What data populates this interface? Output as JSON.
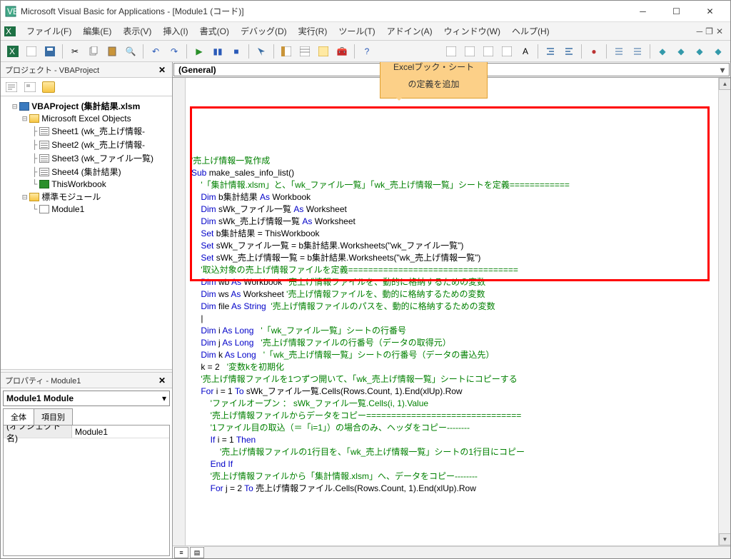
{
  "window": {
    "title": "Microsoft Visual Basic for Applications - [Module1 (コード)]"
  },
  "menu": {
    "file": "ファイル(F)",
    "edit": "編集(E)",
    "view": "表示(V)",
    "insert": "挿入(I)",
    "format": "書式(O)",
    "debug": "デバッグ(D)",
    "run": "実行(R)",
    "tools": "ツール(T)",
    "addins": "アドイン(A)",
    "window": "ウィンドウ(W)",
    "help": "ヘルプ(H)"
  },
  "project_pane": {
    "title": "プロジェクト - VBAProject",
    "root": "VBAProject (集計結果.xlsm",
    "excel_objects": "Microsoft Excel Objects",
    "sheets": [
      "Sheet1 (wk_売上げ情報-",
      "Sheet2 (wk_売上げ情報-",
      "Sheet3 (wk_ファイル一覧)",
      "Sheet4 (集計結果)"
    ],
    "thisworkbook": "ThisWorkbook",
    "std_modules": "標準モジュール",
    "module1": "Module1"
  },
  "properties_pane": {
    "title": "プロパティ - Module1",
    "object": "Module1 Module",
    "tab_all": "全体",
    "tab_category": "項目別",
    "rows": [
      {
        "key": "(オブジェクト名)",
        "val": "Module1"
      }
    ]
  },
  "code": {
    "general": "(General)",
    "lines": [
      {
        "indent": 0,
        "parts": [
          {
            "t": "'売上げ情報一覧作成",
            "c": "c-comment"
          }
        ]
      },
      {
        "indent": 0,
        "parts": [
          {
            "t": "Sub ",
            "c": "c-keyword"
          },
          {
            "t": "make_sales_info_list()",
            "c": "c-text"
          }
        ]
      },
      {
        "indent": 0,
        "parts": [
          {
            "t": "",
            "c": ""
          }
        ]
      },
      {
        "indent": 1,
        "parts": [
          {
            "t": "'「集計情報.xlsm」と、「wk_ファイル一覧」「wk_売上げ情報一覧」シートを定義============",
            "c": "c-comment"
          }
        ]
      },
      {
        "indent": 1,
        "parts": [
          {
            "t": "Dim ",
            "c": "c-keyword"
          },
          {
            "t": "b集計結果 ",
            "c": "c-text"
          },
          {
            "t": "As ",
            "c": "c-keyword"
          },
          {
            "t": "Workbook",
            "c": "c-text"
          }
        ]
      },
      {
        "indent": 1,
        "parts": [
          {
            "t": "Dim ",
            "c": "c-keyword"
          },
          {
            "t": "sWk_ファイル一覧 ",
            "c": "c-text"
          },
          {
            "t": "As ",
            "c": "c-keyword"
          },
          {
            "t": "Worksheet",
            "c": "c-text"
          }
        ]
      },
      {
        "indent": 1,
        "parts": [
          {
            "t": "Dim ",
            "c": "c-keyword"
          },
          {
            "t": "sWk_売上げ情報一覧 ",
            "c": "c-text"
          },
          {
            "t": "As ",
            "c": "c-keyword"
          },
          {
            "t": "Worksheet",
            "c": "c-text"
          }
        ]
      },
      {
        "indent": 0,
        "parts": [
          {
            "t": "",
            "c": ""
          }
        ]
      },
      {
        "indent": 1,
        "parts": [
          {
            "t": "Set ",
            "c": "c-keyword"
          },
          {
            "t": "b集計結果 = ThisWorkbook",
            "c": "c-text"
          }
        ]
      },
      {
        "indent": 1,
        "parts": [
          {
            "t": "Set ",
            "c": "c-keyword"
          },
          {
            "t": "sWk_ファイル一覧 = b集計結果.Worksheets(\"wk_ファイル一覧\")",
            "c": "c-text"
          }
        ]
      },
      {
        "indent": 1,
        "parts": [
          {
            "t": "Set ",
            "c": "c-keyword"
          },
          {
            "t": "sWk_売上げ情報一覧 = b集計結果.Worksheets(\"wk_売上げ情報一覧\")",
            "c": "c-text"
          }
        ]
      },
      {
        "indent": 0,
        "parts": [
          {
            "t": "",
            "c": ""
          }
        ]
      },
      {
        "indent": 0,
        "parts": [
          {
            "t": "",
            "c": ""
          }
        ]
      },
      {
        "indent": 1,
        "parts": [
          {
            "t": "'取込対象の売上げ情報ファイルを定義==================================",
            "c": "c-comment"
          }
        ]
      },
      {
        "indent": 1,
        "parts": [
          {
            "t": "Dim ",
            "c": "c-keyword"
          },
          {
            "t": "wb ",
            "c": "c-text"
          },
          {
            "t": "As ",
            "c": "c-keyword"
          },
          {
            "t": "Workbook  ",
            "c": "c-text"
          },
          {
            "t": "'売上げ情報ファイルを、動的に格納するための変数",
            "c": "c-comment"
          }
        ]
      },
      {
        "indent": 1,
        "parts": [
          {
            "t": "Dim ",
            "c": "c-keyword"
          },
          {
            "t": "ws ",
            "c": "c-text"
          },
          {
            "t": "As ",
            "c": "c-keyword"
          },
          {
            "t": "Worksheet ",
            "c": "c-text"
          },
          {
            "t": "'売上げ情報ファイルを、動的に格納するための変数",
            "c": "c-comment"
          }
        ]
      },
      {
        "indent": 1,
        "parts": [
          {
            "t": "Dim ",
            "c": "c-keyword"
          },
          {
            "t": "file ",
            "c": "c-text"
          },
          {
            "t": "As String  ",
            "c": "c-keyword"
          },
          {
            "t": "'売上げ情報ファイルのパスを、動的に格納するための変数",
            "c": "c-comment"
          }
        ]
      },
      {
        "indent": 0,
        "parts": [
          {
            "t": "",
            "c": ""
          }
        ]
      },
      {
        "indent": 1,
        "parts": [
          {
            "t": "|",
            "c": "c-text"
          }
        ]
      },
      {
        "indent": 1,
        "parts": [
          {
            "t": "Dim ",
            "c": "c-keyword"
          },
          {
            "t": "i ",
            "c": "c-text"
          },
          {
            "t": "As Long   ",
            "c": "c-keyword"
          },
          {
            "t": "'「wk_ファイル一覧」シートの行番号",
            "c": "c-comment"
          }
        ]
      },
      {
        "indent": 1,
        "parts": [
          {
            "t": "Dim ",
            "c": "c-keyword"
          },
          {
            "t": "j ",
            "c": "c-text"
          },
          {
            "t": "As Long   ",
            "c": "c-keyword"
          },
          {
            "t": "'売上げ情報ファイルの行番号（データの取得元）",
            "c": "c-comment"
          }
        ]
      },
      {
        "indent": 1,
        "parts": [
          {
            "t": "Dim ",
            "c": "c-keyword"
          },
          {
            "t": "k ",
            "c": "c-text"
          },
          {
            "t": "As Long   ",
            "c": "c-keyword"
          },
          {
            "t": "'「wk_売上げ情報一覧」シートの行番号（データの書込先）",
            "c": "c-comment"
          }
        ]
      },
      {
        "indent": 1,
        "parts": [
          {
            "t": "k = 2   ",
            "c": "c-text"
          },
          {
            "t": "'変数kを初期化",
            "c": "c-comment"
          }
        ]
      },
      {
        "indent": 0,
        "parts": [
          {
            "t": "",
            "c": ""
          }
        ]
      },
      {
        "indent": 0,
        "parts": [
          {
            "t": "",
            "c": ""
          }
        ]
      },
      {
        "indent": 1,
        "parts": [
          {
            "t": "'売上げ情報ファイルを1つずつ開いて、「wk_売上げ情報一覧」シートにコピーする",
            "c": "c-comment"
          }
        ]
      },
      {
        "indent": 1,
        "parts": [
          {
            "t": "For ",
            "c": "c-keyword"
          },
          {
            "t": "i = 1 ",
            "c": "c-text"
          },
          {
            "t": "To ",
            "c": "c-keyword"
          },
          {
            "t": "sWk_ファイル一覧.Cells(Rows.Count, 1).End(xlUp).Row",
            "c": "c-text"
          }
        ]
      },
      {
        "indent": 0,
        "parts": [
          {
            "t": "",
            "c": ""
          }
        ]
      },
      {
        "indent": 2,
        "parts": [
          {
            "t": "'ファイルオープン ： sWk_ファイル一覧.Cells(i, 1).Value",
            "c": "c-comment"
          }
        ]
      },
      {
        "indent": 0,
        "parts": [
          {
            "t": "",
            "c": ""
          }
        ]
      },
      {
        "indent": 0,
        "parts": [
          {
            "t": "",
            "c": ""
          }
        ]
      },
      {
        "indent": 2,
        "parts": [
          {
            "t": "'売上げ情報ファイルからデータをコピー===============================",
            "c": "c-comment"
          }
        ]
      },
      {
        "indent": 0,
        "parts": [
          {
            "t": "",
            "c": ""
          }
        ]
      },
      {
        "indent": 2,
        "parts": [
          {
            "t": "'1ファイル目の取込（＝「i=1」）の場合のみ、ヘッダをコピー--------",
            "c": "c-comment"
          }
        ]
      },
      {
        "indent": 2,
        "parts": [
          {
            "t": "If ",
            "c": "c-keyword"
          },
          {
            "t": "i = 1 ",
            "c": "c-text"
          },
          {
            "t": "Then",
            "c": "c-keyword"
          }
        ]
      },
      {
        "indent": 0,
        "parts": [
          {
            "t": "",
            "c": ""
          }
        ]
      },
      {
        "indent": 3,
        "parts": [
          {
            "t": "'売上げ情報ファイルの1行目を、「wk_売上げ情報一覧」シートの1行目にコピー",
            "c": "c-comment"
          }
        ]
      },
      {
        "indent": 0,
        "parts": [
          {
            "t": "",
            "c": ""
          }
        ]
      },
      {
        "indent": 2,
        "parts": [
          {
            "t": "End If",
            "c": "c-keyword"
          }
        ]
      },
      {
        "indent": 0,
        "parts": [
          {
            "t": "",
            "c": ""
          }
        ]
      },
      {
        "indent": 0,
        "parts": [
          {
            "t": "",
            "c": ""
          }
        ]
      },
      {
        "indent": 2,
        "parts": [
          {
            "t": "'売上げ情報ファイルから「集計情報.xlsm」へ、データをコピー--------",
            "c": "c-comment"
          }
        ]
      },
      {
        "indent": 2,
        "parts": [
          {
            "t": "For ",
            "c": "c-keyword"
          },
          {
            "t": "j = 2 ",
            "c": "c-text"
          },
          {
            "t": "To ",
            "c": "c-keyword"
          },
          {
            "t": "売上げ情報ファイル.Cells(Rows.Count, 1).End(xlUp).Row",
            "c": "c-text"
          }
        ]
      }
    ]
  },
  "callout": {
    "line1": "Excelブック・シート",
    "line2": "の定義を追加"
  }
}
